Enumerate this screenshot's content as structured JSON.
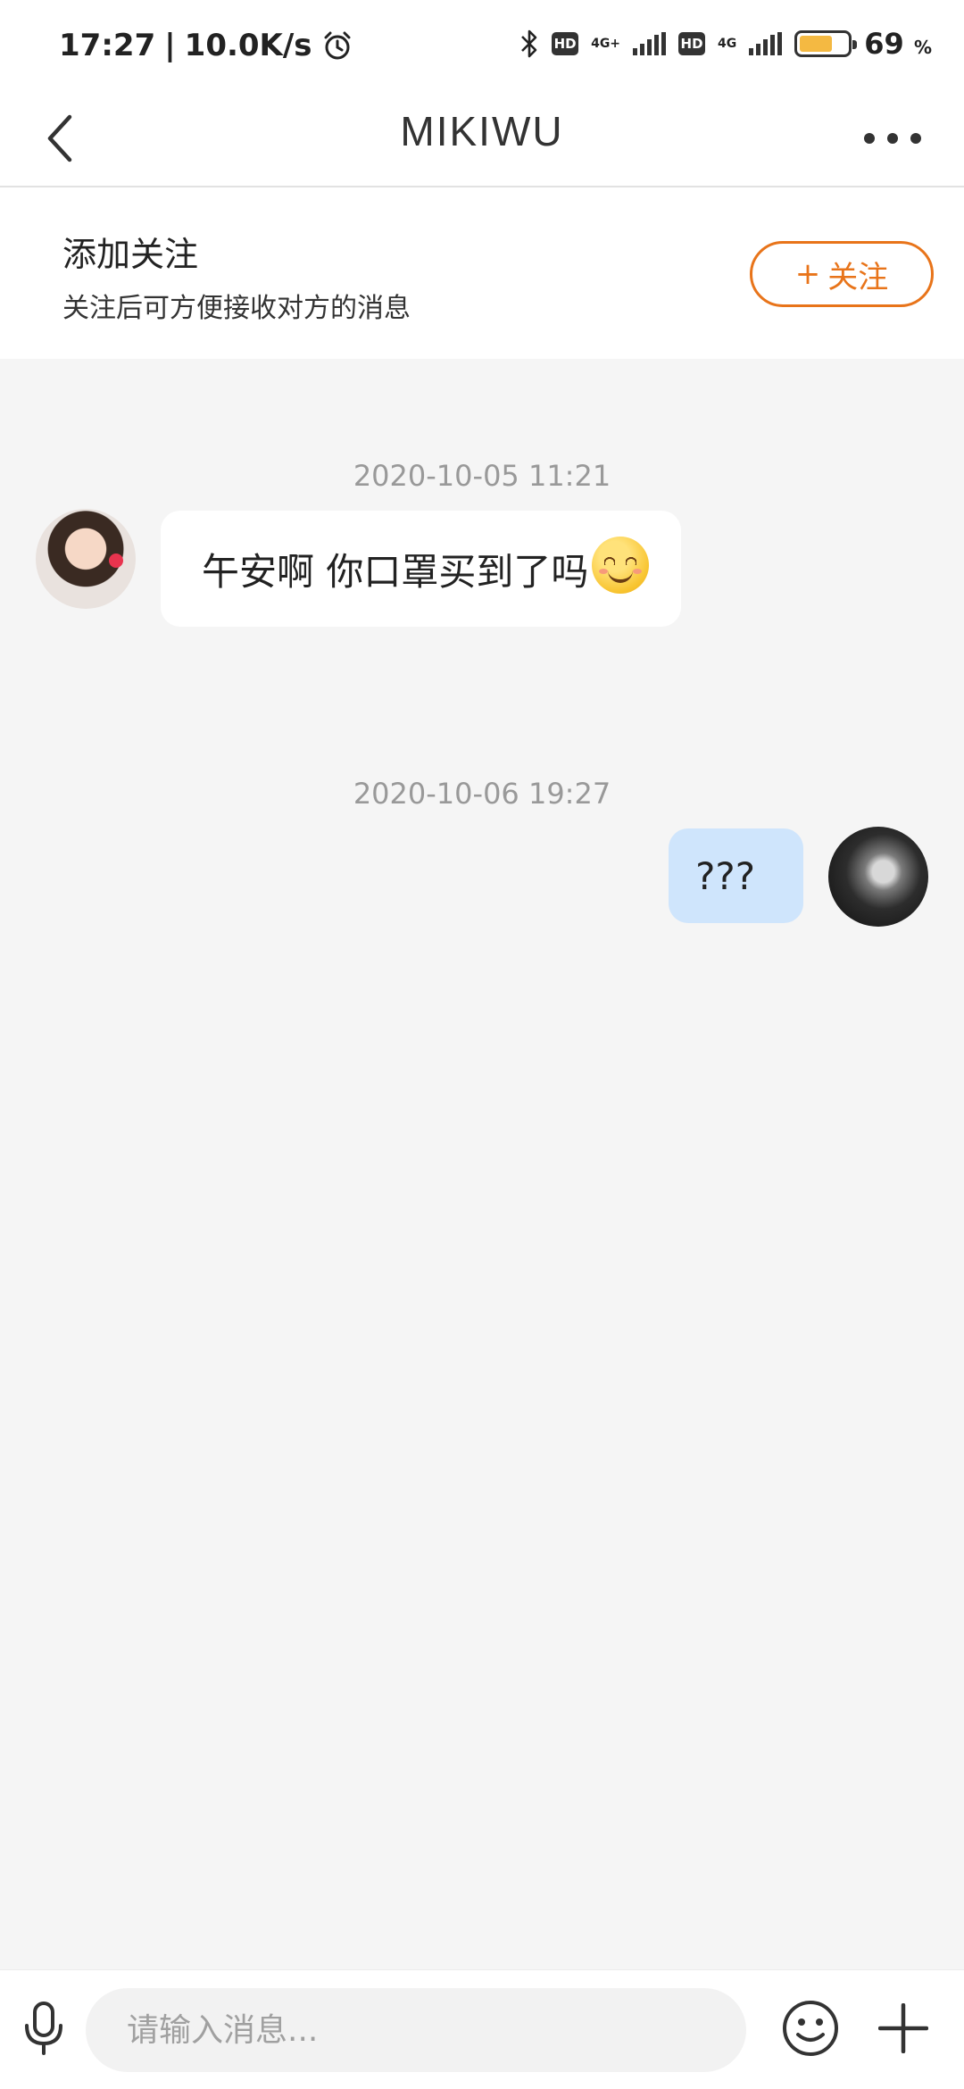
{
  "status_bar": {
    "time": "17:27",
    "separator": "|",
    "net_speed": "10.0K/s",
    "hd_label_1": "HD",
    "network_1": "4G+",
    "hd_label_2": "HD",
    "network_2": "4G",
    "battery_percent": 69,
    "battery_value": "69",
    "battery_unit": "%",
    "icons": [
      "alarm-icon",
      "bluetooth-icon",
      "signal-icon",
      "battery-icon"
    ]
  },
  "nav": {
    "title": "MIKIWU"
  },
  "follow": {
    "title": "添加关注",
    "description": "关注后可方便接收对方的消息",
    "button_plus": "+",
    "button_label": "关注",
    "accent_color": "#e8741a"
  },
  "messages": [
    {
      "timestamp": "2020-10-05 11:21",
      "side": "left",
      "text": "午安啊 你口罩买到了吗",
      "emoji": "smiling-face-emoji"
    },
    {
      "timestamp": "2020-10-06 19:27",
      "side": "right",
      "text": "???"
    }
  ],
  "input": {
    "placeholder": "请输入消息...",
    "value": ""
  }
}
